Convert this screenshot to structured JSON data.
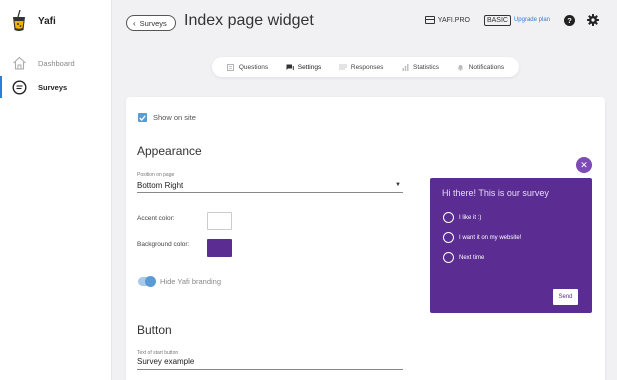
{
  "app": {
    "name": "Yafi"
  },
  "sidebar": {
    "items": [
      {
        "label": "Dashboard",
        "icon": "home-icon",
        "active": false
      },
      {
        "label": "Surveys",
        "icon": "chat-icon",
        "active": true
      }
    ]
  },
  "header": {
    "back_label": "Surveys",
    "title": "Index page widget",
    "site_name": "YAFI.PRO",
    "plan": "BASIC",
    "upgrade_label": "Upgrade plan",
    "help_label": "?"
  },
  "tabs": [
    {
      "label": "Questions",
      "icon": "questions-icon"
    },
    {
      "label": "Settings",
      "icon": "settings-chat-icon",
      "active": true
    },
    {
      "label": "Responses",
      "icon": "responses-icon"
    },
    {
      "label": "Statistics",
      "icon": "statistics-icon"
    },
    {
      "label": "Notifications",
      "icon": "bell-icon"
    }
  ],
  "form": {
    "show_on_site_label": "Show on site",
    "show_on_site": true,
    "appearance_title": "Appearance",
    "position_label": "Position on page",
    "position_value": "Bottom Right",
    "accent_label": "Accent color:",
    "accent_color": "#ffffff",
    "background_label": "Background color:",
    "background_color": "#5b2d93",
    "hide_branding_label": "Hide Yafi branding",
    "hide_branding": true,
    "button_title": "Button",
    "start_button_label": "Text of start button",
    "start_button_value": "Survey example"
  },
  "widget": {
    "title": "Hi there! This is our survey",
    "options": [
      "I like it :)",
      "I want it on my website!",
      "Next time"
    ],
    "send_label": "Send",
    "close_symbol": "✕"
  },
  "colors": {
    "accent_blue": "#2b7fd9",
    "widget_purple": "#5b2d93",
    "close_purple": "#7c4bb5"
  }
}
